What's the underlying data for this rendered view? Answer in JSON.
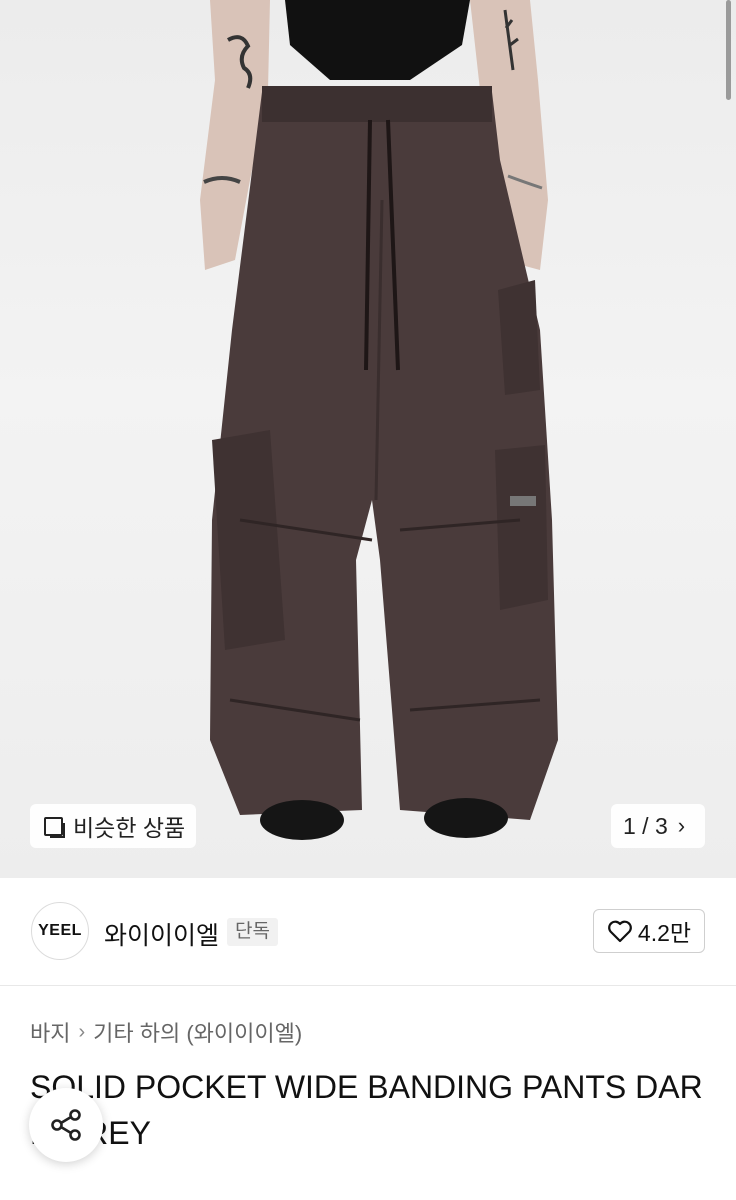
{
  "gallery": {
    "similar_label": "비슷한 상품",
    "counter": "1 / 3"
  },
  "store": {
    "logo_text": "YEEL",
    "name": "와이이이엘",
    "tag": "단독",
    "likes": "4.2만"
  },
  "breadcrumb": {
    "category": "바지",
    "subcategory": "기타 하의 (와이이이엘)"
  },
  "product": {
    "title_line1": "SOLID POCKET WIDE BANDING PANTS DAR",
    "title_line2": "K GREY"
  },
  "icons": [
    "similar-items-icon",
    "chevron-right-icon",
    "heart-icon",
    "chevron-right-icon",
    "share-icon"
  ]
}
